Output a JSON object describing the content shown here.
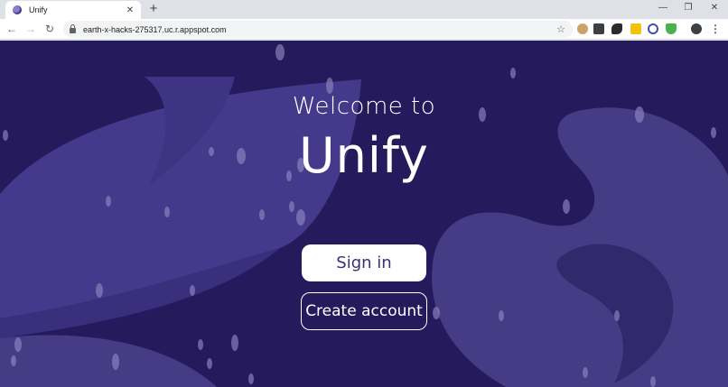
{
  "browser": {
    "tab": {
      "title": "Unify",
      "close_glyph": "✕"
    },
    "new_tab_glyph": "+",
    "window_controls": {
      "minimize": "—",
      "restore": "❐",
      "close": "✕"
    },
    "nav": {
      "back": "←",
      "forward": "→",
      "reload": "↻"
    },
    "address": {
      "url": "earth-x-hacks-275317.uc.r.appspot.com"
    },
    "bookmark_glyph": "☆",
    "menu_glyph": "⋮",
    "extensions": [
      "cookie-icon",
      "pocket-icon",
      "bird-icon",
      "sticky-note-icon",
      "block-icon",
      "shield-icon",
      "profile-avatar"
    ]
  },
  "page": {
    "welcome": "Welcome to",
    "brand": "Unify",
    "signin_label": "Sign in",
    "create_label": "Create account"
  },
  "colors": {
    "background": "#251a5b",
    "blob": "#463c86",
    "leaf": "#4a3f89",
    "button_text": "#3b2f78"
  }
}
